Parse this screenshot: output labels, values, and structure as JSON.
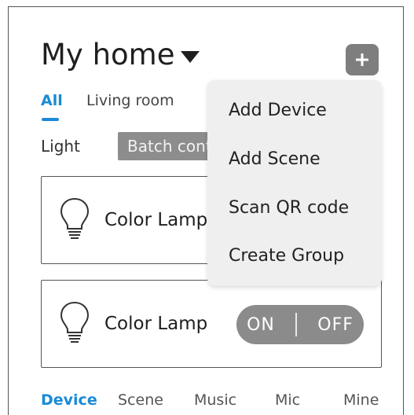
{
  "header": {
    "title": "My home"
  },
  "tabs": [
    {
      "label": "All",
      "active": true
    },
    {
      "label": "Living room",
      "active": false
    }
  ],
  "filter": {
    "light_label": "Light",
    "batch_label": "Batch control"
  },
  "devices": [
    {
      "name": "Color Lamp",
      "icon": "lightbulb-icon"
    },
    {
      "name": "Color Lamp",
      "icon": "lightbulb-icon",
      "toggle": {
        "on": "ON",
        "off": "OFF"
      }
    }
  ],
  "add_menu": {
    "items": [
      "Add Device",
      "Add Scene",
      "Scan QR code",
      "Create Group"
    ]
  },
  "bottom_nav": {
    "items": [
      "Device",
      "Scene",
      "Music",
      "Mic",
      "Mine"
    ],
    "active": "Device"
  },
  "colors": {
    "accent": "#1a8ad6",
    "menu_bg": "#efefef",
    "button_gray": "#8b8b8b"
  }
}
